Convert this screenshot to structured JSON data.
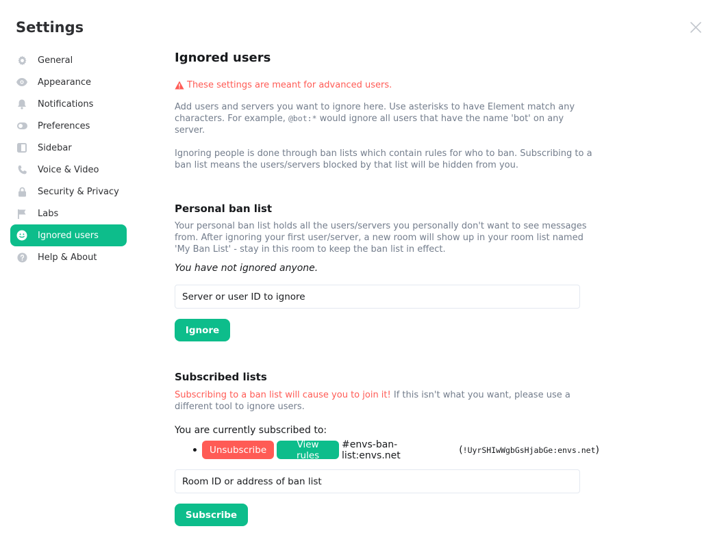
{
  "dialog": {
    "title": "Settings"
  },
  "sidebar": {
    "items": [
      {
        "label": "General",
        "icon": "gear-icon"
      },
      {
        "label": "Appearance",
        "icon": "eye-icon"
      },
      {
        "label": "Notifications",
        "icon": "bell-icon"
      },
      {
        "label": "Preferences",
        "icon": "toggle-icon"
      },
      {
        "label": "Sidebar",
        "icon": "sidebar-icon"
      },
      {
        "label": "Voice & Video",
        "icon": "phone-icon"
      },
      {
        "label": "Security & Privacy",
        "icon": "lock-icon"
      },
      {
        "label": "Labs",
        "icon": "flag-icon"
      },
      {
        "label": "Ignored users",
        "icon": "smiley-icon",
        "active": true
      },
      {
        "label": "Help & About",
        "icon": "help-icon"
      }
    ]
  },
  "main": {
    "heading": "Ignored users",
    "warning": "These settings are meant for advanced users.",
    "intro_before_code": "Add users and servers you want to ignore here. Use asterisks to have Element match any characters. For example, ",
    "intro_code": "@bot:*",
    "intro_after_code": " would ignore all users that have the name 'bot' on any server.",
    "ban_lists_explainer": "Ignoring people is done through ban lists which contain rules for who to ban. Subscribing to a ban list means the users/servers blocked by that list will be hidden from you.",
    "personal": {
      "heading": "Personal ban list",
      "description": "Your personal ban list holds all the users/servers you personally don't want to see messages from. After ignoring your first user/server, a new room will show up in your room list named 'My Ban List' - stay in this room to keep the ban list in effect.",
      "empty_state": "You have not ignored anyone.",
      "input_placeholder": "Server or user ID to ignore",
      "ignore_button": "Ignore"
    },
    "subscribed": {
      "heading": "Subscribed lists",
      "warning_red": "Subscribing to a ban list will cause you to join it!",
      "warning_rest": " If this isn't what you want, please use a different tool to ignore users.",
      "current_label": "You are currently subscribed to:",
      "lists": [
        {
          "unsubscribe_label": "Unsubscribe",
          "view_rules_label": "View rules",
          "room_alias": "#envs-ban-list:envs.net",
          "room_id_open": "(",
          "room_id": "!UyrSHIwWgbGsHjabGe:envs.net",
          "room_id_close": ")"
        }
      ],
      "input_placeholder": "Room ID or address of ban list",
      "subscribe_button": "Subscribe"
    }
  },
  "colors": {
    "accent": "#0dbd8b",
    "alert": "#ff5b55",
    "muted_text": "#737d8c"
  }
}
